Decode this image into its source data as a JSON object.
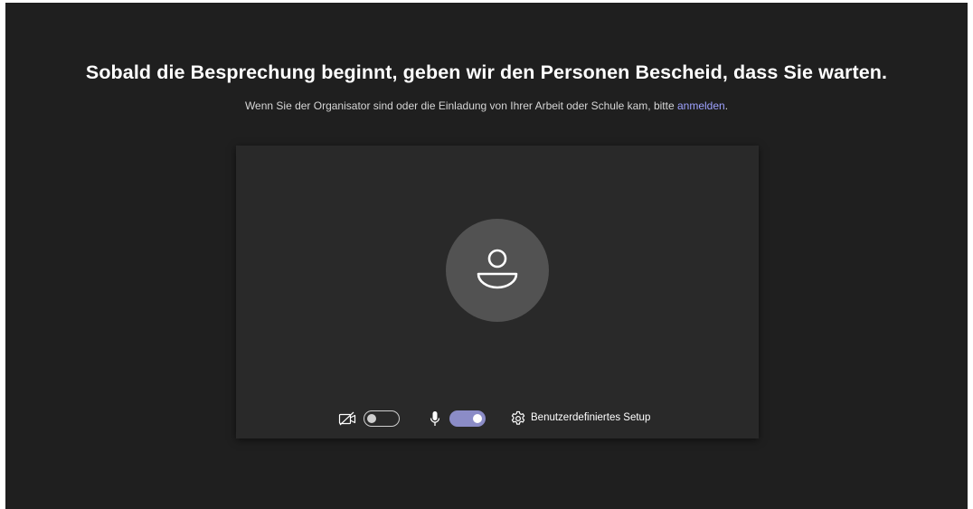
{
  "lobby": {
    "headline": "Sobald die Besprechung beginnt, geben wir den Personen Bescheid, dass Sie warten.",
    "subline_prefix": "Wenn Sie der Organisator sind oder die Einladung von Ihrer Arbeit oder Schule kam, bitte ",
    "signin_link": "anmelden",
    "subline_suffix": "."
  },
  "controls": {
    "camera": {
      "icon": "video-off-icon",
      "enabled": false
    },
    "microphone": {
      "icon": "microphone-icon",
      "enabled": true
    },
    "setup_label": "Benutzerdefiniertes Setup",
    "setup_icon": "gear-icon"
  },
  "colors": {
    "background": "#1f1f1f",
    "preview": "#292929",
    "avatar": "#525252",
    "accent": "#8b8cc7",
    "link": "#9ea2ff"
  }
}
